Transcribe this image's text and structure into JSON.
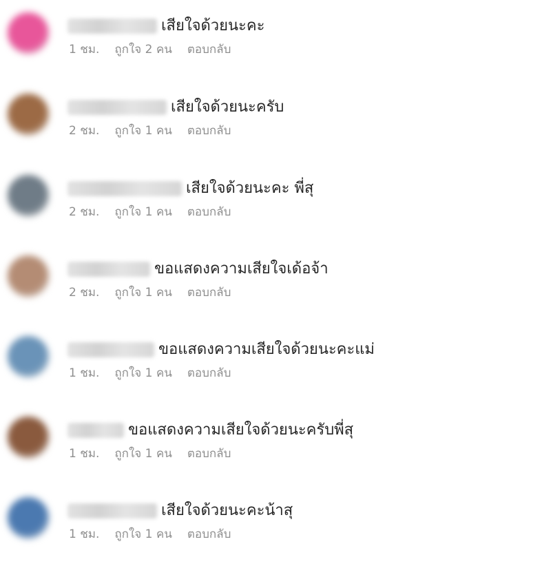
{
  "comments": [
    {
      "text": "เสียใจด้วยนะคะ",
      "time": "1 ชม.",
      "likes": "ถูกใจ 2 คน",
      "reply": "ตอบกลับ",
      "avatar_color": "#e8569a"
    },
    {
      "text": "เสียใจด้วยนะครับ",
      "time": "2 ชม.",
      "likes": "ถูกใจ 1 คน",
      "reply": "ตอบกลับ",
      "avatar_color": "#9c6a45"
    },
    {
      "text": "เสียใจด้วยนะคะ พี่สุ",
      "time": "2 ชม.",
      "likes": "ถูกใจ 1 คน",
      "reply": "ตอบกลับ",
      "avatar_color": "#6f7c87"
    },
    {
      "text": "ขอแสดงความเสียใจเด้อจ้า",
      "time": "2 ชม.",
      "likes": "ถูกใจ 1 คน",
      "reply": "ตอบกลับ",
      "avatar_color": "#b48c74"
    },
    {
      "text": "ขอแสดงความเสียใจด้วยนะคะแม่",
      "time": "1 ชม.",
      "likes": "ถูกใจ 1 คน",
      "reply": "ตอบกลับ",
      "avatar_color": "#6a93b8"
    },
    {
      "text": "ขอแสดงความเสียใจด้วยนะครับพี่สุ",
      "time": "1 ชม.",
      "likes": "ถูกใจ 1 คน",
      "reply": "ตอบกลับ",
      "avatar_color": "#8a5a3e"
    },
    {
      "text": "เสียใจด้วยนะคะน้าสุ",
      "time": "1 ชม.",
      "likes": "ถูกใจ 1 คน",
      "reply": "ตอบกลับ",
      "avatar_color": "#4b79b0"
    }
  ]
}
